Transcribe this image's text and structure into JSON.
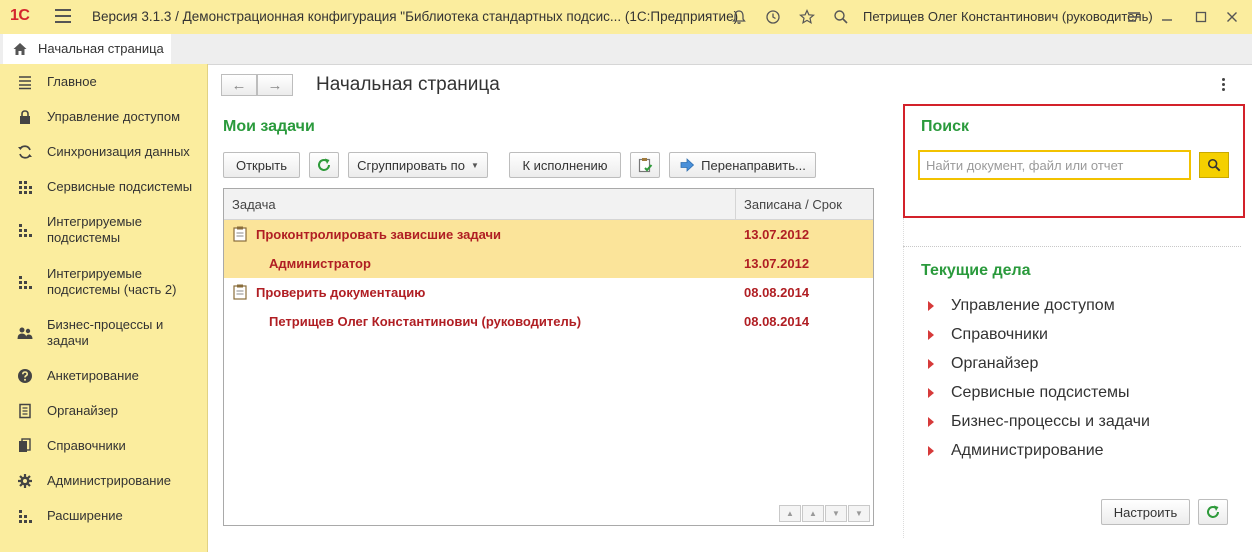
{
  "titlebar": {
    "logo": "1С",
    "title": "Версия 3.1.3 / Демонстрационная конфигурация \"Библиотека стандартных подсис...  (1С:Предприятие)",
    "user": "Петрищев Олег Константинович (руководитель)"
  },
  "tabs": [
    {
      "label": "Начальная страница",
      "icon": "home-icon"
    }
  ],
  "sidebar": {
    "items": [
      {
        "label": "Главное",
        "icon": "menu-lines-icon"
      },
      {
        "label": "Управление доступом",
        "icon": "lock-icon"
      },
      {
        "label": "Синхронизация данных",
        "icon": "sync-icon"
      },
      {
        "label": "Сервисные подсистемы",
        "icon": "dots-grid-icon"
      },
      {
        "label": "Интегрируемые подсистемы",
        "icon": "dots-blocks-icon"
      },
      {
        "label": "Интегрируемые подсистемы (часть 2)",
        "icon": "dots-blocks-icon"
      },
      {
        "label": "Бизнес-процессы и задачи",
        "icon": "people-icon"
      },
      {
        "label": "Анкетирование",
        "icon": "question-icon"
      },
      {
        "label": "Органайзер",
        "icon": "notepad-icon"
      },
      {
        "label": "Справочники",
        "icon": "books-icon"
      },
      {
        "label": "Администрирование",
        "icon": "gear-icon"
      },
      {
        "label": "Расширение",
        "icon": "dots-blocks-icon"
      }
    ]
  },
  "main": {
    "title": "Начальная страница",
    "tasks": {
      "title": "Мои задачи",
      "buttons": {
        "open": "Открыть",
        "group": "Сгруппировать по",
        "execute": "К исполнению",
        "redirect": "Перенаправить..."
      },
      "columns": {
        "task": "Задача",
        "date": "Записана / Срок"
      },
      "rows": [
        {
          "task": "Проконтролировать зависшие задачи",
          "date": "13.07.2012"
        },
        {
          "task": "Администратор",
          "date": "13.07.2012"
        },
        {
          "task": "Проверить документацию",
          "date": "08.08.2014"
        },
        {
          "task": "Петрищев Олег Константинович (руководитель)",
          "date": "08.08.2014"
        }
      ]
    }
  },
  "search": {
    "title": "Поиск",
    "placeholder": "Найти документ, файл или отчет"
  },
  "current": {
    "title": "Текущие дела",
    "items": [
      "Управление доступом",
      "Справочники",
      "Органайзер",
      "Сервисные подсистемы",
      "Бизнес-процессы и задачи",
      "Администрирование"
    ],
    "configure": "Настроить"
  },
  "colors": {
    "accent_yellow": "#fbed9e",
    "section_green": "#2a9a3c",
    "task_red": "#b01e23",
    "highlight_red": "#d3212a",
    "selected_row": "#fbe49a"
  }
}
